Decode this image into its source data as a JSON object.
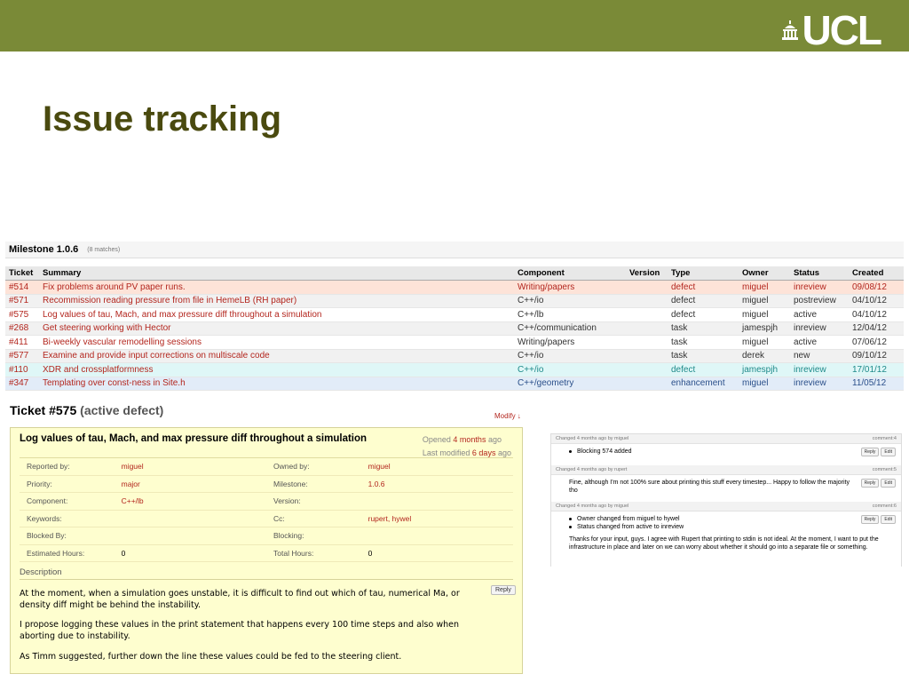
{
  "slide": {
    "title": "Issue tracking",
    "logo_text": "UCL"
  },
  "milestone": {
    "title": "Milestone 1.0.6",
    "matches": "(8 matches)",
    "columns": [
      "Ticket",
      "Summary",
      "Component",
      "Version",
      "Type",
      "Owner",
      "Status",
      "Created"
    ],
    "rows": [
      {
        "ticket": "#514",
        "summary": "Fix problems around PV paper runs.",
        "component": "Writing/papers",
        "version": "",
        "type": "defect",
        "owner": "miguel",
        "status": "inreview",
        "created": "09/08/12"
      },
      {
        "ticket": "#571",
        "summary": "Recommission reading pressure from file in HemeLB (RH paper)",
        "component": "C++/io",
        "version": "",
        "type": "defect",
        "owner": "miguel",
        "status": "postreview",
        "created": "04/10/12"
      },
      {
        "ticket": "#575",
        "summary": "Log values of tau, Mach, and max pressure diff throughout a simulation",
        "component": "C++/lb",
        "version": "",
        "type": "defect",
        "owner": "miguel",
        "status": "active",
        "created": "04/10/12"
      },
      {
        "ticket": "#268",
        "summary": "Get steering working with Hector",
        "component": "C++/communication",
        "version": "",
        "type": "task",
        "owner": "jamespjh",
        "status": "inreview",
        "created": "12/04/12"
      },
      {
        "ticket": "#411",
        "summary": "Bi-weekly vascular remodelling sessions",
        "component": "Writing/papers",
        "version": "",
        "type": "task",
        "owner": "miguel",
        "status": "active",
        "created": "07/06/12"
      },
      {
        "ticket": "#577",
        "summary": "Examine and provide input corrections on multiscale code",
        "component": "C++/io",
        "version": "",
        "type": "task",
        "owner": "derek",
        "status": "new",
        "created": "09/10/12"
      },
      {
        "ticket": "#110",
        "summary": "XDR and crossplatformness",
        "component": "C++/io",
        "version": "",
        "type": "defect",
        "owner": "jamespjh",
        "status": "inreview",
        "created": "17/01/12"
      },
      {
        "ticket": "#347",
        "summary": "Templating over const-ness in Site.h",
        "component": "C++/geometry",
        "version": "",
        "type": "enhancement",
        "owner": "miguel",
        "status": "inreview",
        "created": "11/05/12"
      }
    ]
  },
  "ticket": {
    "heading_prefix": "Ticket",
    "heading_number": "#575",
    "heading_sub": "(active defect)",
    "modify_label": "Modify ↓",
    "summary": "Log values of tau, Mach, and max pressure diff throughout a simulation",
    "opened_label": "Opened",
    "opened_value": "4 months",
    "opened_suffix": "ago",
    "modified_label": "Last modified",
    "modified_value": "6 days",
    "modified_suffix": "ago",
    "props": [
      {
        "k1": "Reported by:",
        "v1": "miguel",
        "k2": "Owned by:",
        "v2": "miguel"
      },
      {
        "k1": "Priority:",
        "v1": "major",
        "k2": "Milestone:",
        "v2": "1.0.6"
      },
      {
        "k1": "Component:",
        "v1": "C++/lb",
        "k2": "Version:",
        "v2": ""
      },
      {
        "k1": "Keywords:",
        "v1": "",
        "k2": "Cc:",
        "v2": "rupert, hywel"
      },
      {
        "k1": "Blocked By:",
        "v1": "",
        "k2": "Blocking:",
        "v2": ""
      },
      {
        "k1": "Estimated Hours:",
        "v1": "0",
        "k2": "Total Hours:",
        "v2": "0"
      }
    ],
    "description_heading": "Description",
    "description": [
      "At the moment, when a simulation goes unstable, it is difficult to find out which of tau, numerical Ma, or density diff might be behind the instability.",
      "I propose logging these values in the print statement that happens every 100 time steps and also when aborting due to instability.",
      "As Timm suggested, further down the line these values could be fed to the steering client."
    ],
    "reply_label": "Reply"
  },
  "comments": [
    {
      "meta": "Changed 4 months ago by miguel",
      "num": "comment:4",
      "lines": [
        "Blocking 574 added"
      ],
      "bullets": true
    },
    {
      "meta": "Changed 4 months ago by rupert",
      "num": "comment:5",
      "lines": [
        "Fine, although I'm not 100% sure about printing this stuff every timestep... Happy to follow the majority tho"
      ],
      "bullets": false
    },
    {
      "meta": "Changed 4 months ago by miguel",
      "num": "comment:6",
      "lines": [
        "Owner changed from miguel to hywel",
        "Status changed from active to inreview"
      ],
      "bullets": true,
      "text": "Thanks for your input, guys. I agree with Rupert that printing to stdin is not ideal. At the moment, I want to put the infrastructure in place and later on we can worry about whether it should go into a separate file or something."
    }
  ],
  "comment_buttons": {
    "reply": "Reply",
    "edit": "Edit"
  },
  "colors": {
    "header_bar": "#7a8a37",
    "title": "#4a4a0f",
    "link_red": "#b3261e",
    "ticket_bg": "#fefecf"
  }
}
